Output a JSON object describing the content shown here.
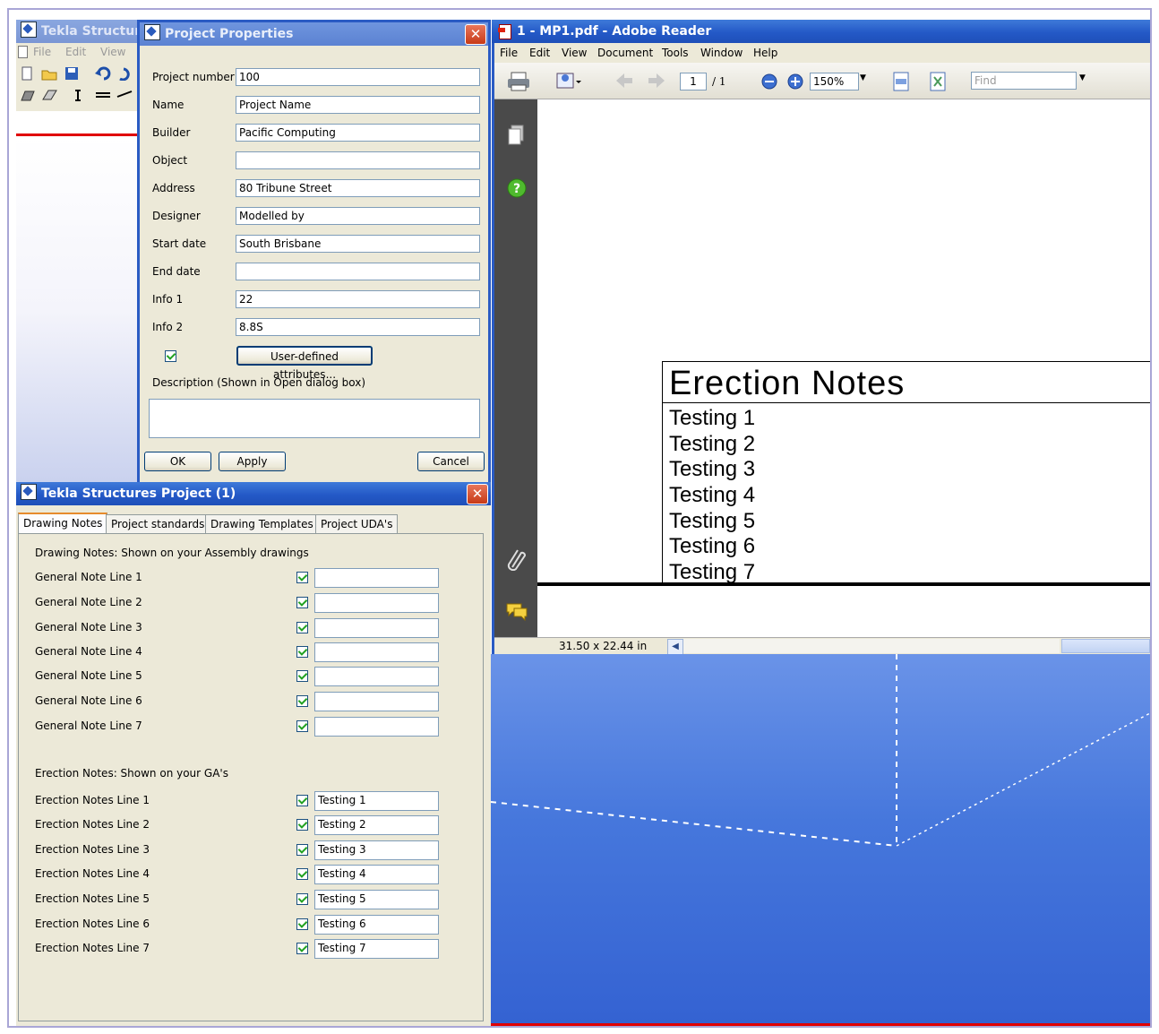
{
  "tekla_main": {
    "title": "Tekla Structures",
    "menu": [
      "File",
      "Edit",
      "View"
    ]
  },
  "project_properties": {
    "title": "Project Properties",
    "fields": [
      {
        "label": "Project number",
        "value": "100"
      },
      {
        "label": "Name",
        "value": "Project Name"
      },
      {
        "label": "Builder",
        "value": "Pacific Computing"
      },
      {
        "label": "Object",
        "value": ""
      },
      {
        "label": "Address",
        "value": "80 Tribune Street"
      },
      {
        "label": "Designer",
        "value": "Modelled by"
      },
      {
        "label": "Start date",
        "value": "South Brisbane"
      },
      {
        "label": "End date",
        "value": ""
      },
      {
        "label": "Info 1",
        "value": "22"
      },
      {
        "label": "Info 2",
        "value": "8.8S"
      }
    ],
    "uda_button": "User-defined attributes...",
    "description_label": "Description (Shown in Open dialog box)",
    "description_value": "",
    "buttons": {
      "ok": "OK",
      "apply": "Apply",
      "cancel": "Cancel"
    }
  },
  "project_window": {
    "title": "Tekla Structures  Project (1)",
    "tabs": [
      "Drawing Notes",
      "Project standards",
      "Drawing Templates",
      "Project UDA's"
    ],
    "drawing_notes_header": "Drawing Notes: Shown on your Assembly drawings",
    "general_lines": [
      {
        "label": "General Note Line 1",
        "value": ""
      },
      {
        "label": "General Note Line 2",
        "value": ""
      },
      {
        "label": "General Note Line 3",
        "value": ""
      },
      {
        "label": "General Note Line 4",
        "value": ""
      },
      {
        "label": "General Note Line 5",
        "value": ""
      },
      {
        "label": "General Note Line 6",
        "value": ""
      },
      {
        "label": "General Note Line 7",
        "value": ""
      }
    ],
    "erection_header": "Erection Notes: Shown on your GA's",
    "erection_lines": [
      {
        "label": "Erection Notes Line 1",
        "value": "Testing 1"
      },
      {
        "label": "Erection Notes Line 2",
        "value": "Testing 2"
      },
      {
        "label": "Erection Notes Line 3",
        "value": "Testing 3"
      },
      {
        "label": "Erection Notes Line 4",
        "value": "Testing 4"
      },
      {
        "label": "Erection Notes Line 5",
        "value": "Testing 5"
      },
      {
        "label": "Erection Notes Line 6",
        "value": "Testing 6"
      },
      {
        "label": "Erection Notes Line 7",
        "value": "Testing 7"
      }
    ]
  },
  "adobe_reader": {
    "title": "1 - MP1.pdf - Adobe Reader",
    "menu": [
      "File",
      "Edit",
      "View",
      "Document",
      "Tools",
      "Window",
      "Help"
    ],
    "page_current": "1",
    "page_total": "/ 1",
    "zoom": "150%",
    "find_placeholder": "Find",
    "page_size": "31.50 x 22.44 in",
    "document": {
      "heading": "Erection Notes",
      "lines": [
        "Testing 1",
        "Testing 2",
        "Testing 3",
        "Testing 4",
        "Testing 5",
        "Testing 6",
        "Testing 7"
      ]
    }
  }
}
